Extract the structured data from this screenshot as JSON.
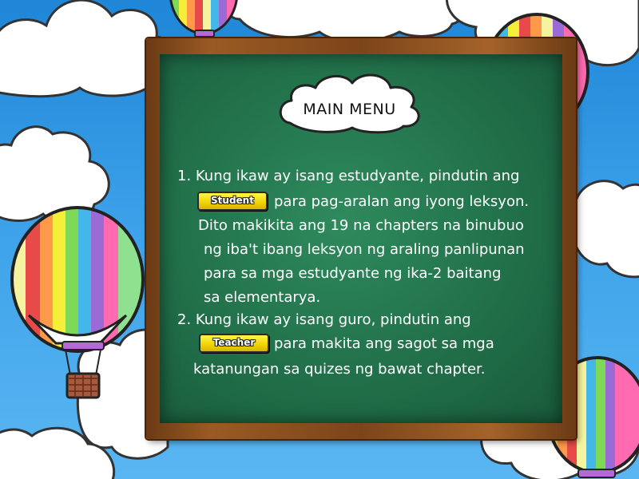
{
  "menu": {
    "title": "MAIN MENU"
  },
  "instructions": {
    "line1": "1. Kung ikaw ay isang estudyante, pindutin ang",
    "line2": "para pag-aralan ang iyong leksyon.",
    "line3": "Dito makikita ang 19 na chapters na binubuo",
    "line4": "ng iba't ibang leksyon ng araling panlipunan",
    "line5": "para sa mga estudyante ng ika-2 baitang",
    "line6": "sa elementarya.",
    "line7": "2. Kung ikaw ay isang guro, pindutin ang",
    "line8": "para makita ang sagot sa mga",
    "line9": "katanungan sa quizes ng bawat chapter."
  },
  "buttons": {
    "student_label": "Student",
    "teacher_label": "Teacher"
  },
  "colors": {
    "sky": "#3aa0e6",
    "chalkboard": "#21704a",
    "frame": "#8a4e1e",
    "button": "#f5e000"
  }
}
